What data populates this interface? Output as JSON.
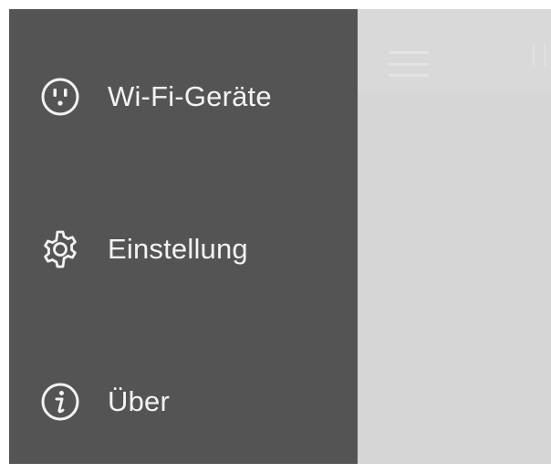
{
  "drawer": {
    "items": [
      {
        "label": "Wi-Fi-Geräte",
        "icon": "wifi-outlet-icon"
      },
      {
        "label": "Einstellung",
        "icon": "gear-icon"
      },
      {
        "label": "Über",
        "icon": "info-icon"
      }
    ]
  },
  "colors": {
    "drawer_bg": "#545454",
    "content_bg": "#d6d6d6",
    "text": "#f3f3f3"
  }
}
